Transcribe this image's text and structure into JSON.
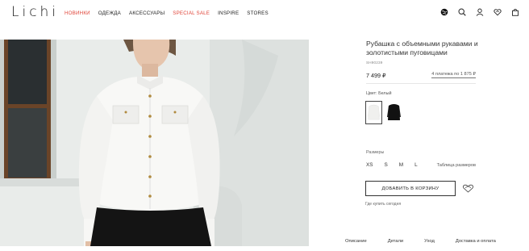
{
  "header": {
    "logo": "Lichi",
    "nav": [
      {
        "label": "НОВИНКИ",
        "accent": true
      },
      {
        "label": "ОДЕЖДА",
        "accent": false
      },
      {
        "label": "АКСЕССУАРЫ",
        "accent": false
      },
      {
        "label": "SPECIAL SALE",
        "accent": true
      },
      {
        "label": "INSPIRE",
        "accent": false
      },
      {
        "label": "STORES",
        "accent": false
      }
    ],
    "icons": [
      "globe-icon",
      "search-icon",
      "user-icon",
      "heart-icon",
      "bag-icon"
    ],
    "accent_color": "#e0453a"
  },
  "product": {
    "title": "Рубашка с объемными рукавами и золотистыми пуговицами",
    "sku": "SH90239",
    "price": "7 499 ₽",
    "installments": "4 платежа по 1 875 ₽",
    "color_label": "Цвет: Белый",
    "colors": [
      {
        "name": "white",
        "selected": true
      },
      {
        "name": "black",
        "selected": false
      }
    ],
    "size_label": "Размеры",
    "sizes": [
      "XS",
      "S",
      "M",
      "L"
    ],
    "size_chart": "Таблица размеров",
    "add_to_cart": "ДОБАВИТЬ В КОРЗИНУ",
    "where_to_buy": "Где купить сегодня",
    "tabs": [
      "Описание",
      "Детали",
      "Уход",
      "Доставка и оплата"
    ]
  }
}
